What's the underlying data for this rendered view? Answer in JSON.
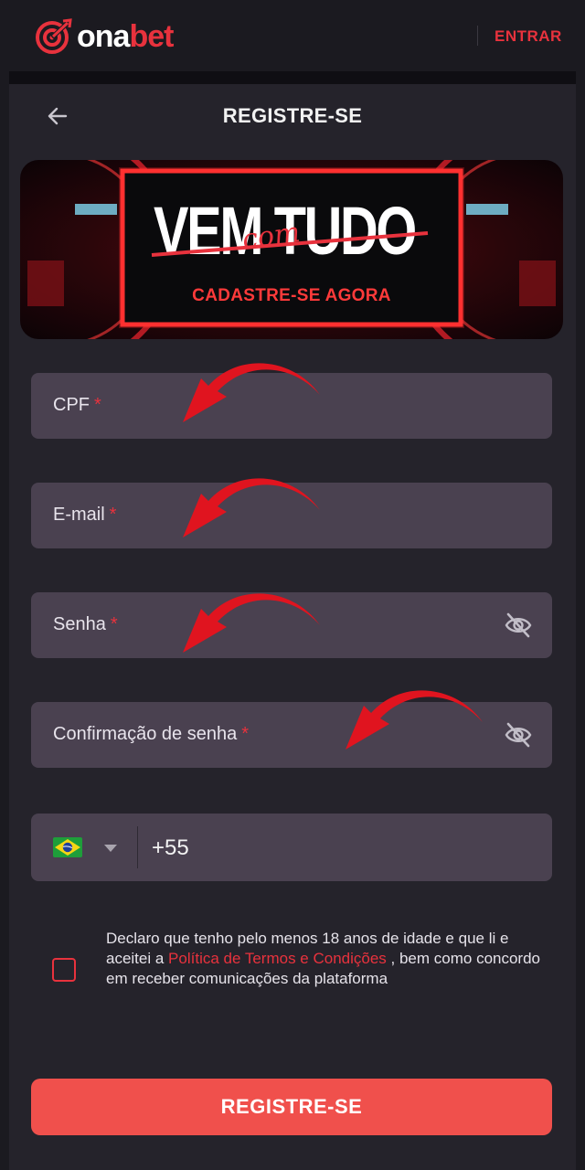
{
  "header": {
    "logo_part1": "ona",
    "logo_part2": "bet",
    "login_label": "ENTRAR"
  },
  "page": {
    "title": "REGISTRE-SE"
  },
  "banner": {
    "headline_left": "VEM",
    "headline_right": "TUDO",
    "headline_middle": "com",
    "subline": "CADASTRE-SE AGORA"
  },
  "form": {
    "cpf_label": "CPF",
    "email_label": "E-mail",
    "password_label": "Senha",
    "confirm_password_label": "Confirmação de senha",
    "required_marker": "*",
    "phone_prefix": "+55",
    "terms_text_1": "Declaro que tenho pelo menos 18 anos de idade e que li e aceitei a ",
    "terms_link": "Política de Termos e Condições",
    "terms_text_2": " , bem como concordo em receber comunicações da plataforma",
    "submit_label": "REGISTRE-SE"
  },
  "icons": {
    "back": "arrow-left-icon",
    "eye": "eye-slash-icon",
    "flag": "brazil-flag-icon",
    "caret": "caret-down-icon",
    "pointer": "red-curved-arrow-icon"
  },
  "colors": {
    "accent": "#e8323d",
    "button": "#f0504c",
    "field_bg": "#4a4150",
    "panel_bg": "#25232b",
    "page_bg": "#1b1a20"
  }
}
